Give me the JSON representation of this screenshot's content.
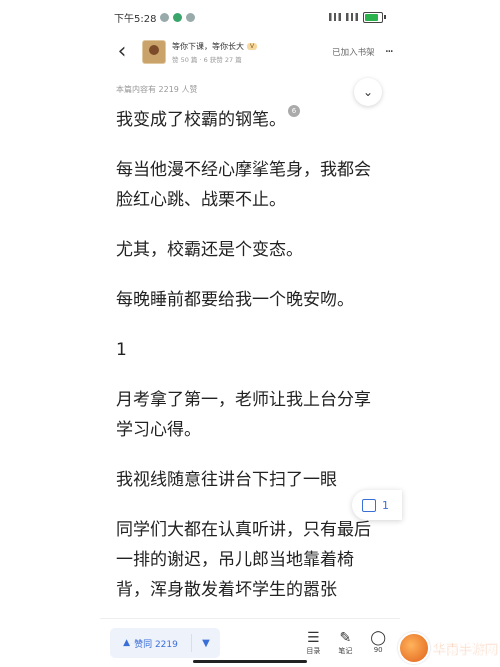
{
  "status_bar": {
    "time": "下午5:28",
    "right_icons": [
      "wifi-signal",
      "signal",
      "battery"
    ]
  },
  "header": {
    "author_name": "等你下课，等你长大",
    "vip_badge": "V",
    "meta": "赞 50 篇 · 6 获赞 27 篇",
    "shelf_label": "已加入书架",
    "more_label": "···"
  },
  "article": {
    "likes_line": "本篇内容有 2219 人赞",
    "badge": "6",
    "paragraphs": [
      "我变成了校霸的钢笔。",
      "每当他漫不经心摩挲笔身，我都会脸红心跳、战栗不止。",
      "尤其，校霸还是个变态。",
      "每晚睡前都要给我一个晚安吻。",
      "1",
      "月考拿了第一，老师让我上台分享学习心得。",
      "我视线随意往讲台下扫了一眼",
      "同学们大都在认真听讲，只有最后一排的谢迟，吊儿郎当地靠着椅背，浑身散发着坏学生的嚣张"
    ]
  },
  "float_comment": {
    "count": "1"
  },
  "bottom_bar": {
    "vote_label": "赞同 2219",
    "tools": [
      {
        "icon": "menu-icon",
        "label": "目录"
      },
      {
        "icon": "pen-icon",
        "label": "笔记"
      },
      {
        "icon": "comment-icon",
        "label": "90"
      }
    ]
  },
  "watermark": {
    "text": "华南手游网"
  }
}
